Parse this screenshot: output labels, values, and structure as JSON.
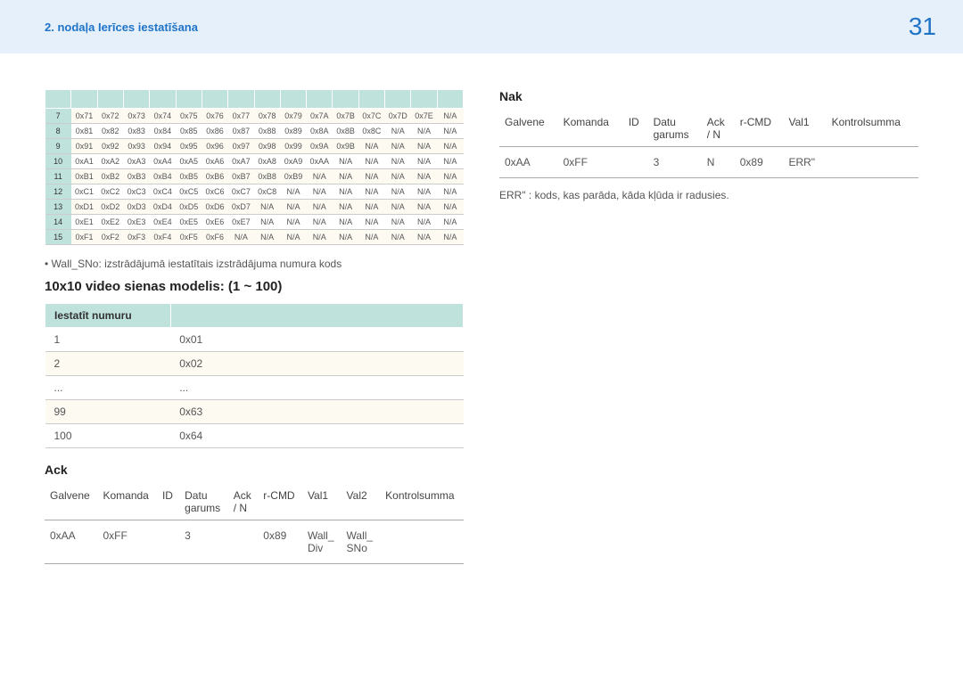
{
  "header": {
    "chapter": "2. nodaļa Ierīces iestatīšana",
    "page": "31"
  },
  "codes": {
    "numcols": 30,
    "rows": [
      {
        "idx": "7",
        "values": [
          "0x71",
          "0x72",
          "0x73",
          "0x74",
          "0x75",
          "0x76",
          "0x77",
          "0x78",
          "0x79",
          "0x7A",
          "0x7B",
          "0x7C",
          "0x7D",
          "0x7E",
          "N/A"
        ]
      },
      {
        "idx": "8",
        "values": [
          "0x81",
          "0x82",
          "0x83",
          "0x84",
          "0x85",
          "0x86",
          "0x87",
          "0x88",
          "0x89",
          "0x8A",
          "0x8B",
          "0x8C",
          "N/A",
          "N/A",
          "N/A"
        ]
      },
      {
        "idx": "9",
        "values": [
          "0x91",
          "0x92",
          "0x93",
          "0x94",
          "0x95",
          "0x96",
          "0x97",
          "0x98",
          "0x99",
          "0x9A",
          "0x9B",
          "N/A",
          "N/A",
          "N/A",
          "N/A"
        ]
      },
      {
        "idx": "10",
        "values": [
          "0xA1",
          "0xA2",
          "0xA3",
          "0xA4",
          "0xA5",
          "0xA6",
          "0xA7",
          "0xA8",
          "0xA9",
          "0xAA",
          "N/A",
          "N/A",
          "N/A",
          "N/A",
          "N/A"
        ]
      },
      {
        "idx": "11",
        "values": [
          "0xB1",
          "0xB2",
          "0xB3",
          "0xB4",
          "0xB5",
          "0xB6",
          "0xB7",
          "0xB8",
          "0xB9",
          "N/A",
          "N/A",
          "N/A",
          "N/A",
          "N/A",
          "N/A"
        ]
      },
      {
        "idx": "12",
        "values": [
          "0xC1",
          "0xC2",
          "0xC3",
          "0xC4",
          "0xC5",
          "0xC6",
          "0xC7",
          "0xC8",
          "N/A",
          "N/A",
          "N/A",
          "N/A",
          "N/A",
          "N/A",
          "N/A"
        ]
      },
      {
        "idx": "13",
        "values": [
          "0xD1",
          "0xD2",
          "0xD3",
          "0xD4",
          "0xD5",
          "0xD6",
          "0xD7",
          "N/A",
          "N/A",
          "N/A",
          "N/A",
          "N/A",
          "N/A",
          "N/A",
          "N/A"
        ]
      },
      {
        "idx": "14",
        "values": [
          "0xE1",
          "0xE2",
          "0xE3",
          "0xE4",
          "0xE5",
          "0xE6",
          "0xE7",
          "N/A",
          "N/A",
          "N/A",
          "N/A",
          "N/A",
          "N/A",
          "N/A",
          "N/A"
        ]
      },
      {
        "idx": "15",
        "values": [
          "0xF1",
          "0xF2",
          "0xF3",
          "0xF4",
          "0xF5",
          "0xF6",
          "N/A",
          "N/A",
          "N/A",
          "N/A",
          "N/A",
          "N/A",
          "N/A",
          "N/A",
          "N/A"
        ]
      }
    ]
  },
  "wall_note": "Wall_SNo: izstrādājumā iestatītais izstrādājuma numura kods",
  "model_heading": "10x10 video sienas modelis: (1 ~ 100)",
  "setnum": {
    "head1": "Iestatīt numuru",
    "head2": "       ",
    "rows": [
      {
        "a": "1",
        "b": "0x01"
      },
      {
        "a": "2",
        "b": "0x02"
      },
      {
        "a": "...",
        "b": "..."
      },
      {
        "a": "99",
        "b": "0x63"
      },
      {
        "a": "100",
        "b": "0x64"
      }
    ]
  },
  "ack": {
    "title": "Ack",
    "headers": [
      "Galvene",
      "Komanda",
      "ID",
      "Datu garums",
      "Ack / N",
      "r-CMD",
      "Val1",
      "Val2",
      "Kontrolsumma"
    ],
    "row": [
      "0xAA",
      "0xFF",
      "",
      "3",
      "",
      "0x89",
      "Wall_Div",
      "Wall_SNo",
      ""
    ]
  },
  "nak": {
    "title": "Nak",
    "headers": [
      "Galvene",
      "Komanda",
      "ID",
      "Datu garums",
      "Ack / N",
      "r-CMD",
      "Val1",
      "Kontrolsumma"
    ],
    "row": [
      "0xAA",
      "0xFF",
      "",
      "3",
      "N",
      "0x89",
      "ERR\"",
      ""
    ],
    "err": "ERR\" : kods, kas parāda, kāda kļūda ir radusies."
  }
}
